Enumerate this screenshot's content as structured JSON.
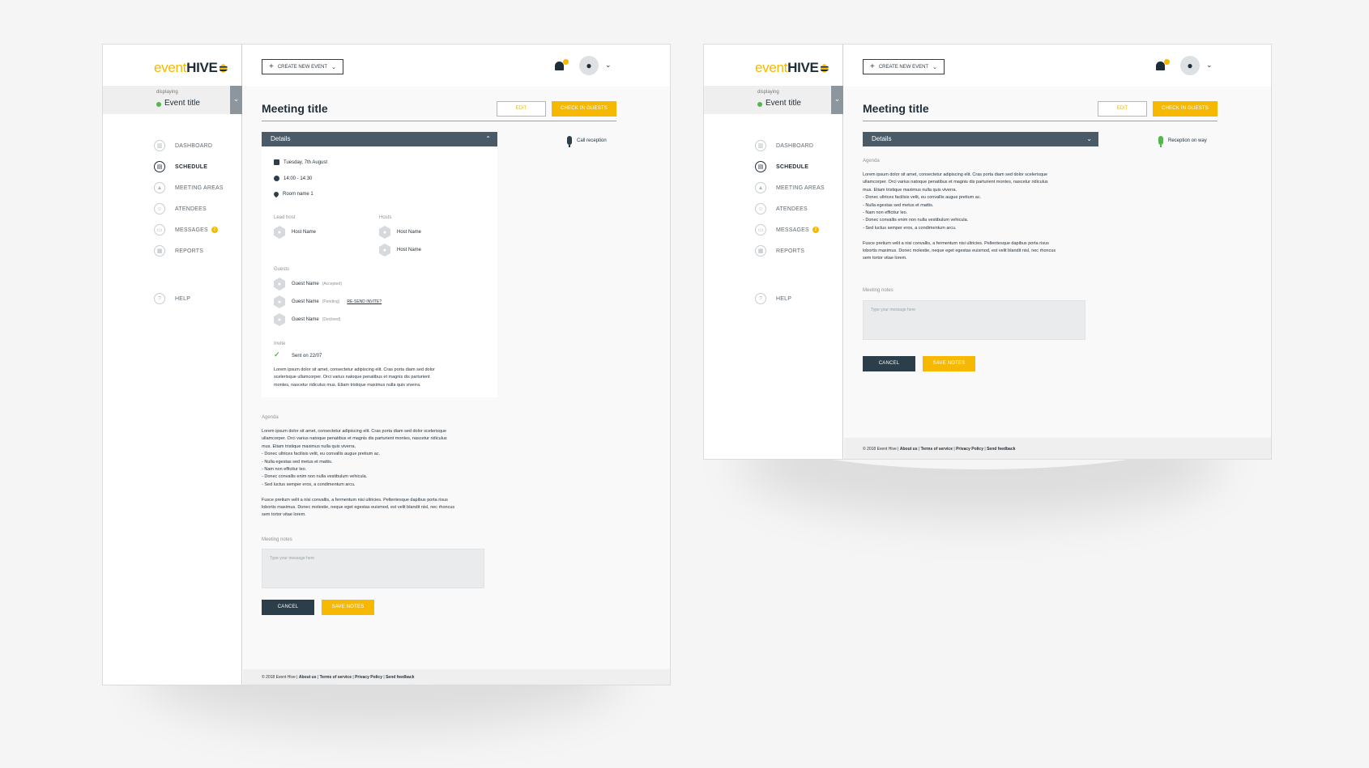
{
  "brand": {
    "left": "event",
    "right": "HIVE",
    "accent": "#f6b800",
    "dark": "#1f2d38"
  },
  "event_switch": {
    "label": "displaying",
    "title": "Event title"
  },
  "nav": [
    {
      "label": "DASHBOARD",
      "icon": "dashboard-icon"
    },
    {
      "label": "SCHEDULE",
      "icon": "schedule-icon",
      "active": true
    },
    {
      "label": "MEETING AREAS",
      "icon": "meeting-areas-icon"
    },
    {
      "label": "ATENDEES",
      "icon": "attendees-icon"
    },
    {
      "label": "MESSAGES",
      "icon": "messages-icon",
      "badge": "2"
    },
    {
      "label": "REPORTS",
      "icon": "reports-icon"
    }
  ],
  "help": "HELP",
  "create_btn": "CREATE NEW EVENT",
  "notif_count": "1",
  "page": {
    "title": "Meeting title",
    "edit": "EDIT",
    "check_in": "CHECK IN GUESTS"
  },
  "details": {
    "header": "Details",
    "date": "Tuesday, 7th August",
    "time": "14:00 - 14:30",
    "room": "Room name 1",
    "lead_host_label": "Lead host",
    "lead_host": "Host Name",
    "hosts_label": "Hosts",
    "hosts": [
      "Host Name",
      "Host Name"
    ],
    "guests_label": "Guests",
    "guests": [
      {
        "name": "Guest Name",
        "status": "(Accepted)"
      },
      {
        "name": "Guest Name",
        "status": "(Pending)",
        "action": "RE-SEND INVITE?"
      },
      {
        "name": "Guest Name",
        "status": "(Declined)"
      }
    ],
    "invite_label": "Invite",
    "invite_sent": "Sent on 22/07",
    "invite_text": "Lorem ipsum dolor sit amet, consectetur adipiscing elit. Cras porta diam sed dolor\nscelerisque ullamcorper. Orci varius natoque penatibus et magnis dis parturient\nmontes, nascetur ridiculus mus. Etiam tristique maximus nulla quis viverra."
  },
  "call_reception": "Call reception",
  "reception_on_way": "Reception on way",
  "agenda": {
    "label": "Agenda",
    "text": "Lorem ipsum dolor sit amet, consectetur adipiscing elit. Cras porta diam sed dolor scelerisque\nullamcorper. Orci varius natoque penatibus et magnis dis parturient montes, nascetur ridiculus\nmus. Etiam tristique maximus nulla quis viverra.\n- Donec ultrices facilisis velit, eu convallis augue pretium ac.\n- Nulla egestas sed metus et mattis.\n- Nam non efficitur leo.\n- Donec convallis enim non nulla vestibulum vehicula.\n- Sed luctus semper eros, a condimentum arcu.\n\nFusce pretium velit a nisi convallis, a fermentum nisi ultricies. Pellentesque dapibus porta risus\nlobortis maximus. Donec molestie, neque eget egestas euismod, est velit blandit nisl, nec rhoncus\nsem tortor vitae lorem."
  },
  "notes": {
    "label": "Meeting notes",
    "placeholder": "Type your message here",
    "cancel": "CANCEL",
    "save": "SAVE NOTES"
  },
  "footer": {
    "copy": "© 2018 Event Hive |",
    "about": "About us",
    "sep": "|",
    "terms": "Terms of service",
    "privacy": "Privacy Policy",
    "feedback": "Send feedback"
  }
}
